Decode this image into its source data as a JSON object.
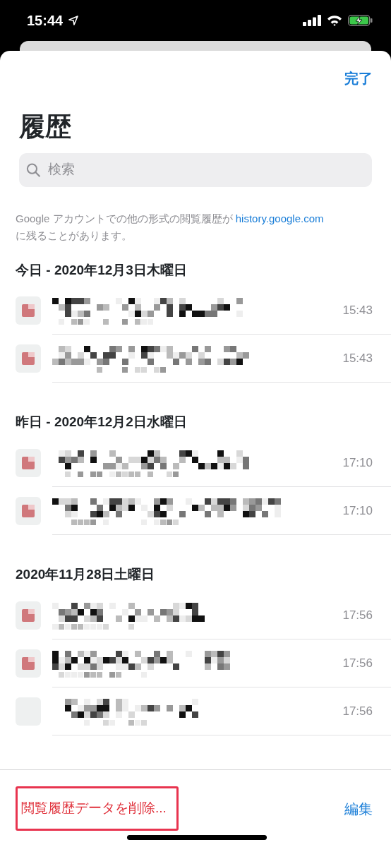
{
  "status_bar": {
    "time": "15:44"
  },
  "header": {
    "done_button": "完了",
    "title": "履歴"
  },
  "search": {
    "placeholder": "検索"
  },
  "note": {
    "text": "Google アカウントでの他の形式の閲覧履歴が",
    "link": "history.google.com",
    "text_after": "に残ることがあります。"
  },
  "sections": [
    {
      "heading": "今日 - 2020年12月3日木曜日",
      "items": [
        {
          "time": "15:43",
          "favicon": true
        },
        {
          "time": "15:43",
          "favicon": true
        }
      ]
    },
    {
      "heading": "昨日 - 2020年12月2日水曜日",
      "items": [
        {
          "time": "17:10",
          "favicon": true
        },
        {
          "time": "17:10",
          "favicon": true
        }
      ]
    },
    {
      "heading": "2020年11月28日土曜日",
      "items": [
        {
          "time": "17:56",
          "favicon": true
        },
        {
          "time": "17:56",
          "favicon": true
        },
        {
          "time": "17:56",
          "favicon": false
        }
      ]
    }
  ],
  "toolbar": {
    "clear_button": "閲覧履歴データを削除...",
    "clear_highlighted": true,
    "edit_button": "編集"
  }
}
